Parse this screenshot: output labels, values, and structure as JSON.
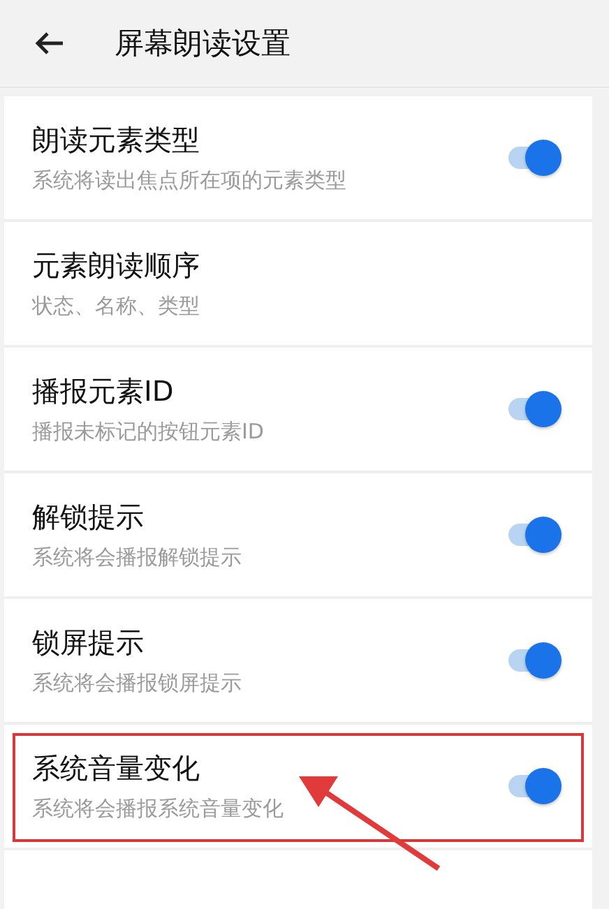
{
  "header": {
    "title": "屏幕朗读设置"
  },
  "settings": [
    {
      "kind": "toggle",
      "title": "朗读元素类型",
      "subtitle": "系统将读出焦点所在项的元素类型",
      "on": true,
      "highlighted": false
    },
    {
      "kind": "text",
      "title": "元素朗读顺序",
      "subtitle": "状态、名称、类型",
      "highlighted": false
    },
    {
      "kind": "toggle",
      "title": "播报元素ID",
      "subtitle": "播报未标记的按钮元素ID",
      "on": true,
      "highlighted": false
    },
    {
      "kind": "toggle",
      "title": "解锁提示",
      "subtitle": "系统将会播报解锁提示",
      "on": true,
      "highlighted": false
    },
    {
      "kind": "toggle",
      "title": "锁屏提示",
      "subtitle": "系统将会播报锁屏提示",
      "on": true,
      "highlighted": false
    },
    {
      "kind": "toggle",
      "title": "系统音量变化",
      "subtitle": "系统将会播报系统音量变化",
      "on": true,
      "highlighted": true
    }
  ]
}
